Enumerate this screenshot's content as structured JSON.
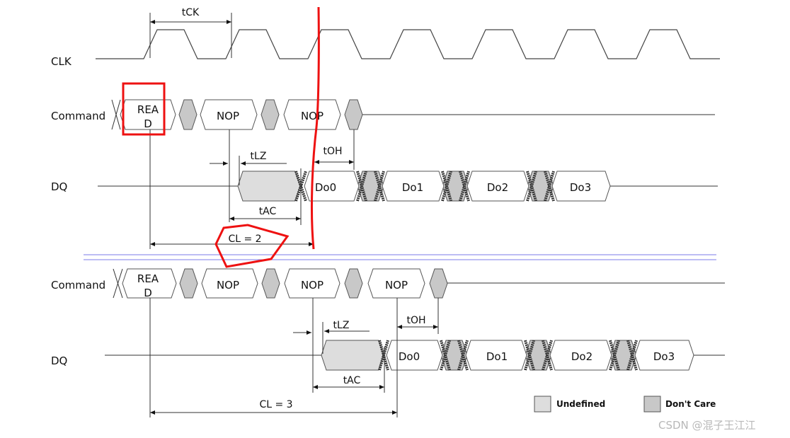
{
  "signals": {
    "clk": "CLK",
    "command_1": "Command",
    "dq_1": "DQ",
    "command_2": "Command",
    "dq_2": "DQ"
  },
  "timing_1": {
    "tck": "tCK",
    "tlz": "tLZ",
    "toh": "tOH",
    "tac": "tAC",
    "cl": "CL = 2",
    "commands": [
      "REA",
      "D",
      "NOP",
      "NOP"
    ],
    "data": [
      "Do0",
      "Do1",
      "Do2",
      "Do3"
    ]
  },
  "timing_2": {
    "tlz": "tLZ",
    "toh": "tOH",
    "tac": "tAC",
    "cl": "CL = 3",
    "commands": [
      "REA",
      "D",
      "NOP",
      "NOP",
      "NOP"
    ],
    "data": [
      "Do0",
      "Do1",
      "Do2",
      "Do3"
    ]
  },
  "legend": {
    "undefined": "Undefined",
    "dont_care": "Don't Care"
  },
  "watermark": "CSDN @混子王江江",
  "colors": {
    "undefined": "#dddddd",
    "dont_care": "#c8c8c8",
    "annotation": "#ee1111",
    "separator": "#7b7bea"
  }
}
